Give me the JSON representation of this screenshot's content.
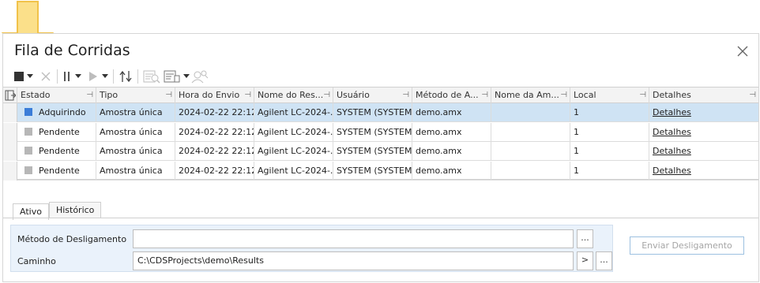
{
  "window": {
    "title": "Fila de Corridas",
    "close_icon": "close-icon"
  },
  "toolbar": {
    "icons": [
      "stop-icon",
      "dropdown-icon",
      "cancel-icon",
      "pause-icon",
      "dropdown-icon",
      "play-icon",
      "dropdown-icon",
      "sort-icon",
      "queue-search-icon",
      "queue-properties-icon",
      "dropdown-icon",
      "user-search-icon"
    ]
  },
  "grid": {
    "columns": [
      "Estado",
      "Tipo",
      "Hora do Envio",
      "Nome do Res...",
      "Usuário",
      "Método de A...",
      "Nome da Am...",
      "Local",
      "Detalhes"
    ],
    "rows": [
      {
        "estado": "Adquirindo",
        "status_color": "#3b7dd8",
        "tipo": "Amostra única",
        "hora": "2024-02-22 22:12...",
        "nome": "Agilent LC-2024-...",
        "usuario": "SYSTEM (SYSTEM)",
        "metodo": "demo.amx",
        "nome_am": "",
        "local": "1",
        "detalhes": "Detalhes"
      },
      {
        "estado": "Pendente",
        "status_color": "#b7b7b7",
        "tipo": "Amostra única",
        "hora": "2024-02-22 22:12...",
        "nome": "Agilent LC-2024-...",
        "usuario": "SYSTEM (SYSTEM)",
        "metodo": "demo.amx",
        "nome_am": "",
        "local": "1",
        "detalhes": "Detalhes"
      },
      {
        "estado": "Pendente",
        "status_color": "#b7b7b7",
        "tipo": "Amostra única",
        "hora": "2024-02-22 22:12...",
        "nome": "Agilent LC-2024-...",
        "usuario": "SYSTEM (SYSTEM)",
        "metodo": "demo.amx",
        "nome_am": "",
        "local": "1",
        "detalhes": "Detalhes"
      },
      {
        "estado": "Pendente",
        "status_color": "#b7b7b7",
        "tipo": "Amostra única",
        "hora": "2024-02-22 22:12...",
        "nome": "Agilent LC-2024-...",
        "usuario": "SYSTEM (SYSTEM)",
        "metodo": "demo.amx",
        "nome_am": "",
        "local": "1",
        "detalhes": "Detalhes"
      }
    ]
  },
  "tabs": [
    {
      "label": "Ativo"
    },
    {
      "label": "Histórico"
    }
  ],
  "form": {
    "metodo_label": "Método de Desligamento",
    "metodo_value": "",
    "caminho_label": "Caminho",
    "caminho_value": "C:\\CDSProjects\\demo\\Results",
    "browse_label": "...",
    "go_label": ">"
  },
  "send_button": {
    "label": "Enviar Desligamento"
  },
  "colors": {
    "selected_row": "#cfe3f4",
    "accent": "#3b7dd8",
    "highlight_arrow": "#f9d56e"
  }
}
